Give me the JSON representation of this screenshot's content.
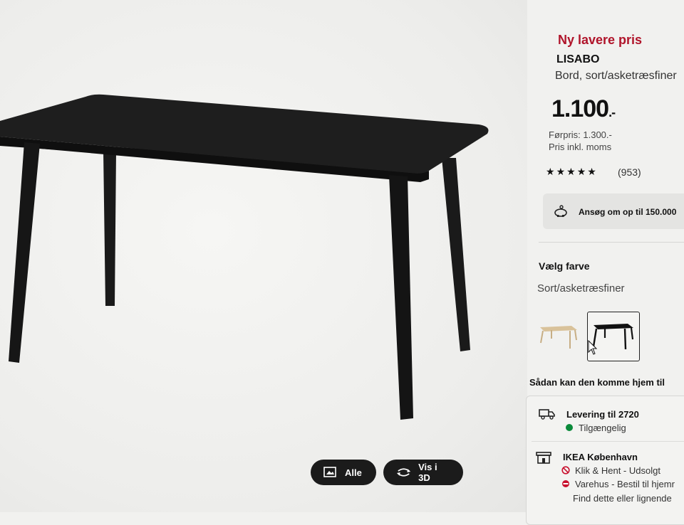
{
  "gallery": {
    "all_label": "Alle",
    "view3d_label": "Vis i 3D"
  },
  "product": {
    "badge": "Ny lavere pris",
    "name": "LISABO",
    "description": "Bord, sort/asketræsfiner",
    "price": "1.100",
    "price_suffix": ".-",
    "previous_price": "Førpris: 1.300.-",
    "vat_note": "Pris inkl. moms",
    "rating": 4.5,
    "rating_count": "(953)"
  },
  "finance": {
    "text": "Ansøg om op til 150.000"
  },
  "color_picker": {
    "heading": "Vælg farve",
    "selected": "Sort/asketræsfiner",
    "options": [
      {
        "icon": "table-ash-thumbnail",
        "selected": false
      },
      {
        "icon": "table-black-thumbnail",
        "selected": true
      }
    ]
  },
  "delivery": {
    "heading": "Sådan kan den komme hjem til",
    "home_title": "Levering til 2720",
    "home_status": "Tilgængelig",
    "store_title": "IKEA København",
    "click_collect": "Klik & Hent - Udsolgt",
    "warehouse": "Varehus - Bestil til hjemr",
    "find_here": "Find dette eller lignende"
  },
  "colors": {
    "accent_red": "#b0142a",
    "available_green": "#0a8a3a",
    "button_dark": "#1b1b1b"
  }
}
